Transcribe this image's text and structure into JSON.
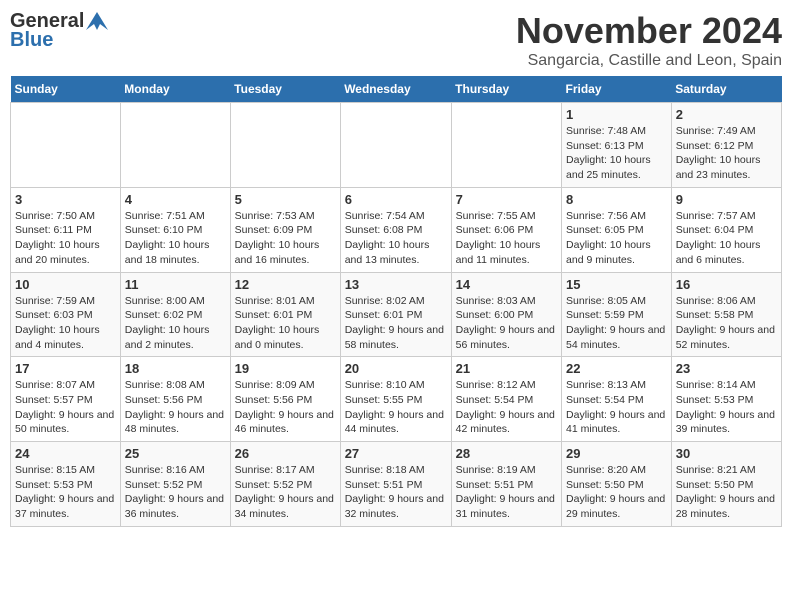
{
  "logo": {
    "general": "General",
    "blue": "Blue"
  },
  "title": "November 2024",
  "location": "Sangarcia, Castille and Leon, Spain",
  "weekdays": [
    "Sunday",
    "Monday",
    "Tuesday",
    "Wednesday",
    "Thursday",
    "Friday",
    "Saturday"
  ],
  "weeks": [
    [
      {
        "day": "",
        "info": ""
      },
      {
        "day": "",
        "info": ""
      },
      {
        "day": "",
        "info": ""
      },
      {
        "day": "",
        "info": ""
      },
      {
        "day": "",
        "info": ""
      },
      {
        "day": "1",
        "info": "Sunrise: 7:48 AM\nSunset: 6:13 PM\nDaylight: 10 hours and 25 minutes."
      },
      {
        "day": "2",
        "info": "Sunrise: 7:49 AM\nSunset: 6:12 PM\nDaylight: 10 hours and 23 minutes."
      }
    ],
    [
      {
        "day": "3",
        "info": "Sunrise: 7:50 AM\nSunset: 6:11 PM\nDaylight: 10 hours and 20 minutes."
      },
      {
        "day": "4",
        "info": "Sunrise: 7:51 AM\nSunset: 6:10 PM\nDaylight: 10 hours and 18 minutes."
      },
      {
        "day": "5",
        "info": "Sunrise: 7:53 AM\nSunset: 6:09 PM\nDaylight: 10 hours and 16 minutes."
      },
      {
        "day": "6",
        "info": "Sunrise: 7:54 AM\nSunset: 6:08 PM\nDaylight: 10 hours and 13 minutes."
      },
      {
        "day": "7",
        "info": "Sunrise: 7:55 AM\nSunset: 6:06 PM\nDaylight: 10 hours and 11 minutes."
      },
      {
        "day": "8",
        "info": "Sunrise: 7:56 AM\nSunset: 6:05 PM\nDaylight: 10 hours and 9 minutes."
      },
      {
        "day": "9",
        "info": "Sunrise: 7:57 AM\nSunset: 6:04 PM\nDaylight: 10 hours and 6 minutes."
      }
    ],
    [
      {
        "day": "10",
        "info": "Sunrise: 7:59 AM\nSunset: 6:03 PM\nDaylight: 10 hours and 4 minutes."
      },
      {
        "day": "11",
        "info": "Sunrise: 8:00 AM\nSunset: 6:02 PM\nDaylight: 10 hours and 2 minutes."
      },
      {
        "day": "12",
        "info": "Sunrise: 8:01 AM\nSunset: 6:01 PM\nDaylight: 10 hours and 0 minutes."
      },
      {
        "day": "13",
        "info": "Sunrise: 8:02 AM\nSunset: 6:01 PM\nDaylight: 9 hours and 58 minutes."
      },
      {
        "day": "14",
        "info": "Sunrise: 8:03 AM\nSunset: 6:00 PM\nDaylight: 9 hours and 56 minutes."
      },
      {
        "day": "15",
        "info": "Sunrise: 8:05 AM\nSunset: 5:59 PM\nDaylight: 9 hours and 54 minutes."
      },
      {
        "day": "16",
        "info": "Sunrise: 8:06 AM\nSunset: 5:58 PM\nDaylight: 9 hours and 52 minutes."
      }
    ],
    [
      {
        "day": "17",
        "info": "Sunrise: 8:07 AM\nSunset: 5:57 PM\nDaylight: 9 hours and 50 minutes."
      },
      {
        "day": "18",
        "info": "Sunrise: 8:08 AM\nSunset: 5:56 PM\nDaylight: 9 hours and 48 minutes."
      },
      {
        "day": "19",
        "info": "Sunrise: 8:09 AM\nSunset: 5:56 PM\nDaylight: 9 hours and 46 minutes."
      },
      {
        "day": "20",
        "info": "Sunrise: 8:10 AM\nSunset: 5:55 PM\nDaylight: 9 hours and 44 minutes."
      },
      {
        "day": "21",
        "info": "Sunrise: 8:12 AM\nSunset: 5:54 PM\nDaylight: 9 hours and 42 minutes."
      },
      {
        "day": "22",
        "info": "Sunrise: 8:13 AM\nSunset: 5:54 PM\nDaylight: 9 hours and 41 minutes."
      },
      {
        "day": "23",
        "info": "Sunrise: 8:14 AM\nSunset: 5:53 PM\nDaylight: 9 hours and 39 minutes."
      }
    ],
    [
      {
        "day": "24",
        "info": "Sunrise: 8:15 AM\nSunset: 5:53 PM\nDaylight: 9 hours and 37 minutes."
      },
      {
        "day": "25",
        "info": "Sunrise: 8:16 AM\nSunset: 5:52 PM\nDaylight: 9 hours and 36 minutes."
      },
      {
        "day": "26",
        "info": "Sunrise: 8:17 AM\nSunset: 5:52 PM\nDaylight: 9 hours and 34 minutes."
      },
      {
        "day": "27",
        "info": "Sunrise: 8:18 AM\nSunset: 5:51 PM\nDaylight: 9 hours and 32 minutes."
      },
      {
        "day": "28",
        "info": "Sunrise: 8:19 AM\nSunset: 5:51 PM\nDaylight: 9 hours and 31 minutes."
      },
      {
        "day": "29",
        "info": "Sunrise: 8:20 AM\nSunset: 5:50 PM\nDaylight: 9 hours and 29 minutes."
      },
      {
        "day": "30",
        "info": "Sunrise: 8:21 AM\nSunset: 5:50 PM\nDaylight: 9 hours and 28 minutes."
      }
    ]
  ]
}
